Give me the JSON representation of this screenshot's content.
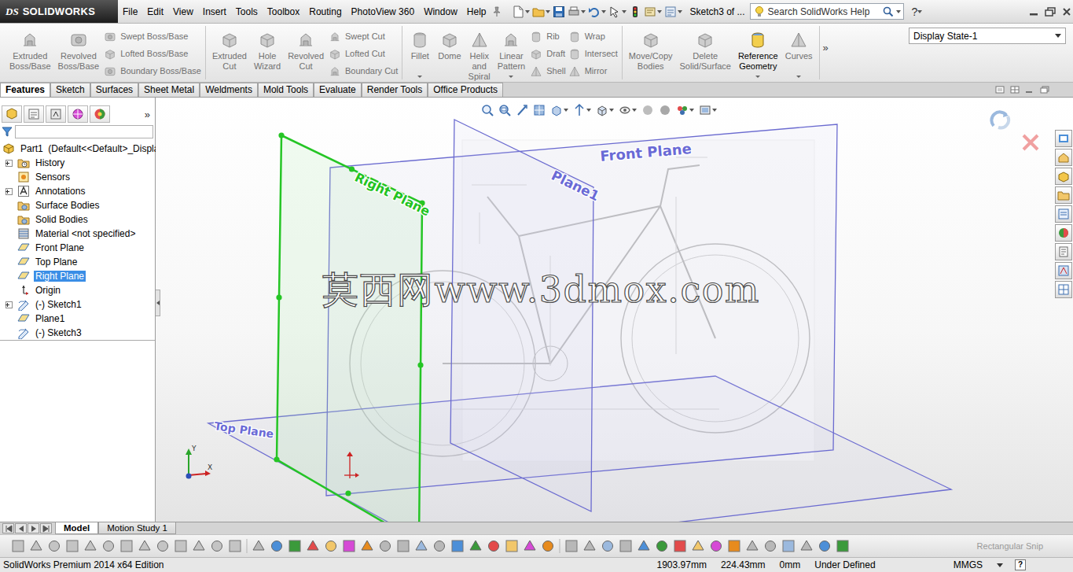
{
  "app": {
    "logo_mark": "DS",
    "logo_name": "SOLIDWORKS"
  },
  "menu": [
    "File",
    "Edit",
    "View",
    "Insert",
    "Tools",
    "Toolbox",
    "Routing",
    "PhotoView 360",
    "Window",
    "Help"
  ],
  "document_title": "Sketch3 of ...",
  "search": {
    "placeholder": "Search SolidWorks Help"
  },
  "help_button": "?",
  "ribbon": {
    "groups": [
      {
        "columns": [
          {
            "kind": "large",
            "label": "Extruded Boss/Base",
            "disabled": true,
            "dropdown": false
          },
          {
            "kind": "large",
            "label": "Revolved Boss/Base",
            "disabled": true,
            "dropdown": false
          },
          {
            "kind": "stack",
            "items": [
              {
                "label": "Swept Boss/Base",
                "disabled": true
              },
              {
                "label": "Lofted Boss/Base",
                "disabled": true
              },
              {
                "label": "Boundary Boss/Base",
                "disabled": true
              }
            ]
          }
        ]
      },
      {
        "columns": [
          {
            "kind": "large",
            "label": "Extruded Cut",
            "disabled": true,
            "dropdown": false
          },
          {
            "kind": "large",
            "label": "Hole Wizard",
            "disabled": true,
            "dropdown": false
          },
          {
            "kind": "large",
            "label": "Revolved Cut",
            "disabled": true,
            "dropdown": false
          },
          {
            "kind": "stack",
            "items": [
              {
                "label": "Swept Cut",
                "disabled": true
              },
              {
                "label": "Lofted Cut",
                "disabled": true
              },
              {
                "label": "Boundary Cut",
                "disabled": true
              }
            ]
          }
        ]
      },
      {
        "columns": [
          {
            "kind": "large",
            "label": "Fillet",
            "disabled": true,
            "dropdown": true
          },
          {
            "kind": "large",
            "label": "Dome",
            "disabled": true,
            "dropdown": false
          },
          {
            "kind": "large",
            "label": "Helix and Spiral",
            "disabled": true,
            "dropdown": false
          },
          {
            "kind": "large",
            "label": "Linear Pattern",
            "disabled": true,
            "dropdown": true
          },
          {
            "kind": "stack",
            "items": [
              {
                "label": "Rib",
                "disabled": true
              },
              {
                "label": "Draft",
                "disabled": true
              },
              {
                "label": "Shell",
                "disabled": true
              }
            ]
          },
          {
            "kind": "stack",
            "items": [
              {
                "label": "Wrap",
                "disabled": true
              },
              {
                "label": "Intersect",
                "disabled": true
              },
              {
                "label": "Mirror",
                "disabled": true
              }
            ]
          }
        ]
      },
      {
        "columns": [
          {
            "kind": "large",
            "label": "Move/Copy Bodies",
            "disabled": true,
            "dropdown": false
          },
          {
            "kind": "large",
            "label": "Delete Solid/Surface",
            "disabled": true,
            "dropdown": false
          },
          {
            "kind": "large",
            "label": "Reference Geometry",
            "disabled": false,
            "dropdown": true
          },
          {
            "kind": "large",
            "label": "Curves",
            "disabled": true,
            "dropdown": true
          }
        ]
      }
    ],
    "overflow": "»"
  },
  "display_state": "Display State-1",
  "command_tabs": [
    {
      "label": "Features",
      "selected": true
    },
    {
      "label": "Sketch",
      "selected": false
    },
    {
      "label": "Surfaces",
      "selected": false
    },
    {
      "label": "Sheet Metal",
      "selected": false
    },
    {
      "label": "Weldments",
      "selected": false
    },
    {
      "label": "Mold Tools",
      "selected": false
    },
    {
      "label": "Evaluate",
      "selected": false
    },
    {
      "label": "Render Tools",
      "selected": false
    },
    {
      "label": "Office Products",
      "selected": false
    }
  ],
  "feature_manager": {
    "overflow": "»",
    "root": "Part1  (Default<<Default>_Displa",
    "items": [
      {
        "label": "History",
        "kind": "history",
        "expandable": true,
        "selected": false
      },
      {
        "label": "Sensors",
        "kind": "sensors",
        "expandable": false,
        "selected": false
      },
      {
        "label": "Annotations",
        "kind": "annotations",
        "expandable": true,
        "selected": false
      },
      {
        "label": "Surface Bodies",
        "kind": "bodies",
        "expandable": false,
        "selected": false
      },
      {
        "label": "Solid Bodies",
        "kind": "bodies",
        "expandable": false,
        "selected": false
      },
      {
        "label": "Material <not specified>",
        "kind": "material",
        "expandable": false,
        "selected": false
      },
      {
        "label": "Front Plane",
        "kind": "plane",
        "expandable": false,
        "selected": false
      },
      {
        "label": "Top Plane",
        "kind": "plane",
        "expandable": false,
        "selected": false
      },
      {
        "label": "Right Plane",
        "kind": "plane",
        "expandable": false,
        "selected": true
      },
      {
        "label": "Origin",
        "kind": "origin",
        "expandable": false,
        "selected": false
      },
      {
        "label": "(-) Sketch1",
        "kind": "sketch",
        "expandable": true,
        "selected": false
      },
      {
        "label": "Plane1",
        "kind": "plane",
        "expandable": false,
        "selected": false
      },
      {
        "label": "(-) Sketch3",
        "kind": "sketch",
        "expandable": false,
        "selected": false
      }
    ]
  },
  "viewport": {
    "planes": [
      {
        "label": "Front Plane",
        "selected": false
      },
      {
        "label": "Right Plane",
        "selected": true
      },
      {
        "label": "Plane1",
        "selected": false
      },
      {
        "label": "Top Plane",
        "selected": false
      }
    ],
    "watermark": "莫西网www.3dmox.com",
    "triad": {
      "x": "X",
      "y": "Y"
    }
  },
  "bottom_tabs": [
    {
      "label": "Model",
      "selected": true
    },
    {
      "label": "Motion Study 1",
      "selected": false
    }
  ],
  "toolbar_hint": "Rectangular Snip",
  "status_bar": {
    "edition": "SolidWorks Premium 2014 x64 Edition",
    "coordinates": [
      "1903.97mm",
      "224.43mm",
      "0mm"
    ],
    "sketch_state": "Under Defined",
    "units": "MMGS",
    "help": "?"
  }
}
